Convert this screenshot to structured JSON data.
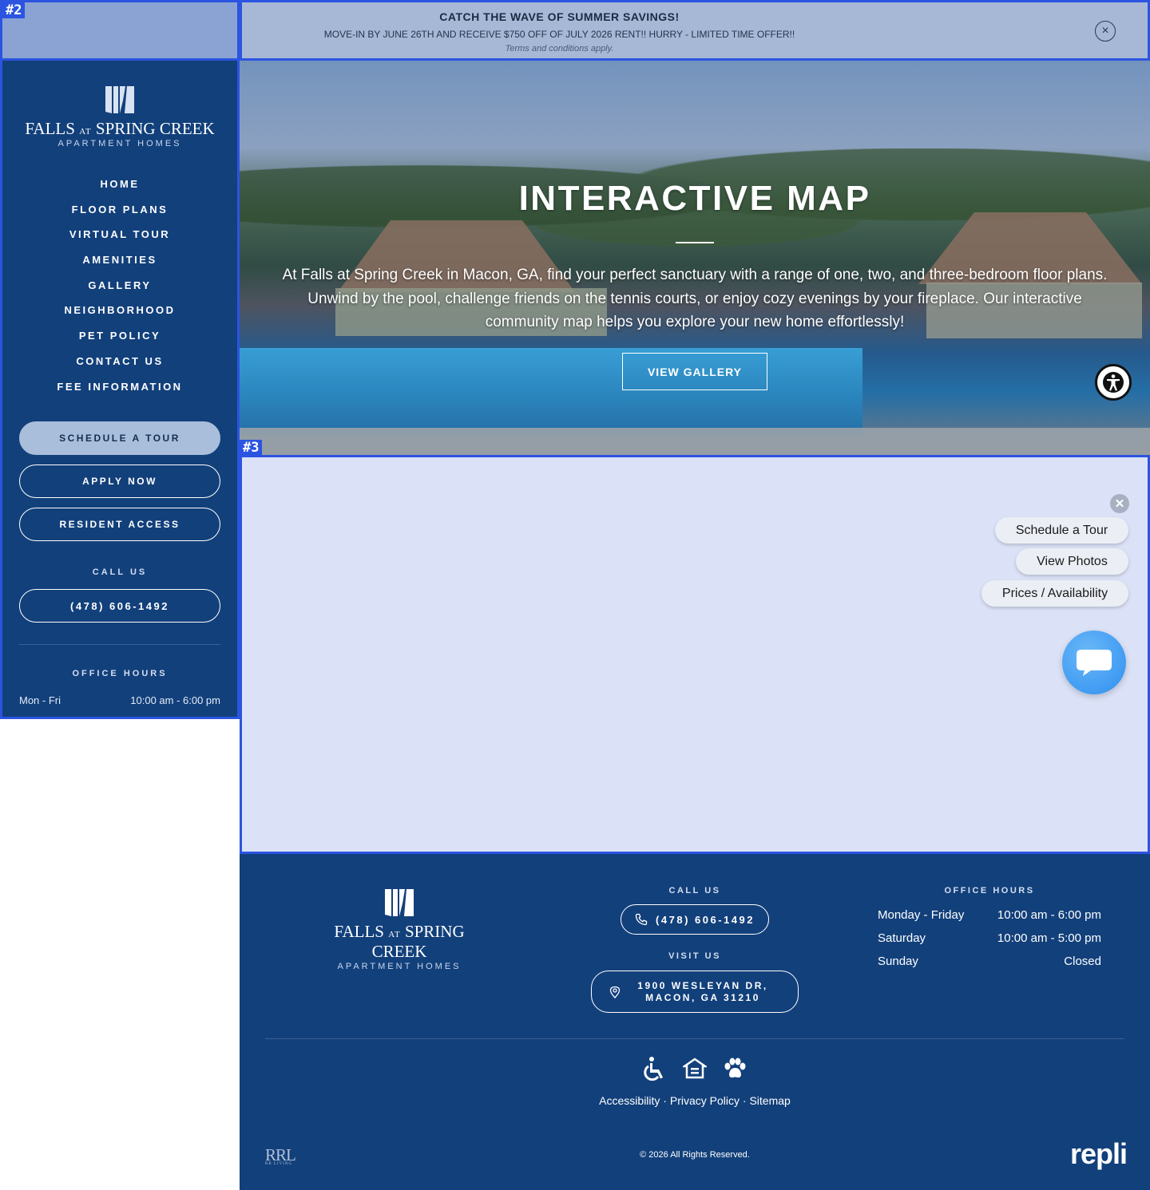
{
  "overlay_tags": {
    "tag2": "#2",
    "tag3": "#3"
  },
  "promo": {
    "title": "CATCH THE WAVE OF SUMMER SAVINGS!",
    "body": "MOVE-IN BY JUNE 26TH AND RECEIVE $750 OFF OF JULY 2026 RENT!! HURRY - LIMITED TIME OFFER!!",
    "terms": "Terms and conditions apply.",
    "close_icon": "×"
  },
  "brand": {
    "name_part1": "FALLS",
    "name_at": "AT",
    "name_part2": "SPRING CREEK",
    "tagline": "APARTMENT HOMES"
  },
  "nav": {
    "items": [
      "HOME",
      "FLOOR PLANS",
      "VIRTUAL TOUR",
      "AMENITIES",
      "GALLERY",
      "NEIGHBORHOOD",
      "PET POLICY",
      "CONTACT US",
      "FEE INFORMATION"
    ]
  },
  "sidebar": {
    "schedule_tour": "SCHEDULE A TOUR",
    "apply_now": "APPLY NOW",
    "resident_access": "RESIDENT ACCESS",
    "call_label": "CALL US",
    "phone": "(478) 606-1492",
    "hours_label": "OFFICE HOURS",
    "hours_days": "Mon - Fri",
    "hours_time": "10:00 am - 6:00 pm"
  },
  "hero": {
    "title": "INTERACTIVE MAP",
    "description": "At Falls at Spring Creek in Macon, GA, find your perfect sanctuary with a range of one, two, and three-bedroom floor plans. Unwind by the pool, challenge friends on the tennis courts, or enjoy cozy evenings by your fireplace. Our interactive community map helps you explore your new home effortlessly!",
    "button": "VIEW GALLERY"
  },
  "widget": {
    "close_icon": "✕",
    "buttons": [
      "Schedule a Tour",
      "View Photos",
      "Prices / Availability"
    ]
  },
  "footer": {
    "call_label": "CALL US",
    "phone": "(478) 606-1492",
    "visit_label": "VISIT US",
    "address_line1": "1900 WESLEYAN DR,",
    "address_line2": "MACON, GA 31210",
    "hours_label": "OFFICE HOURS",
    "hours": [
      {
        "day": "Monday - Friday",
        "time": "10:00 am - 6:00 pm"
      },
      {
        "day": "Saturday",
        "time": "10:00 am - 5:00 pm"
      },
      {
        "day": "Sunday",
        "time": "Closed"
      }
    ],
    "links": [
      "Accessibility",
      "Privacy Policy",
      "Sitemap"
    ],
    "link_separator": " · ",
    "copyright": "© 2026 All Rights Reserved.",
    "rrl_logo": "RRL",
    "rrl_sub": "RR LIVING",
    "repli_logo": "repli"
  },
  "colors": {
    "brand_navy": "#12407b",
    "overlay_blue": "#2b54e0",
    "map_bg": "#dbe2f7",
    "chat_blue": "#2e8ff0"
  }
}
